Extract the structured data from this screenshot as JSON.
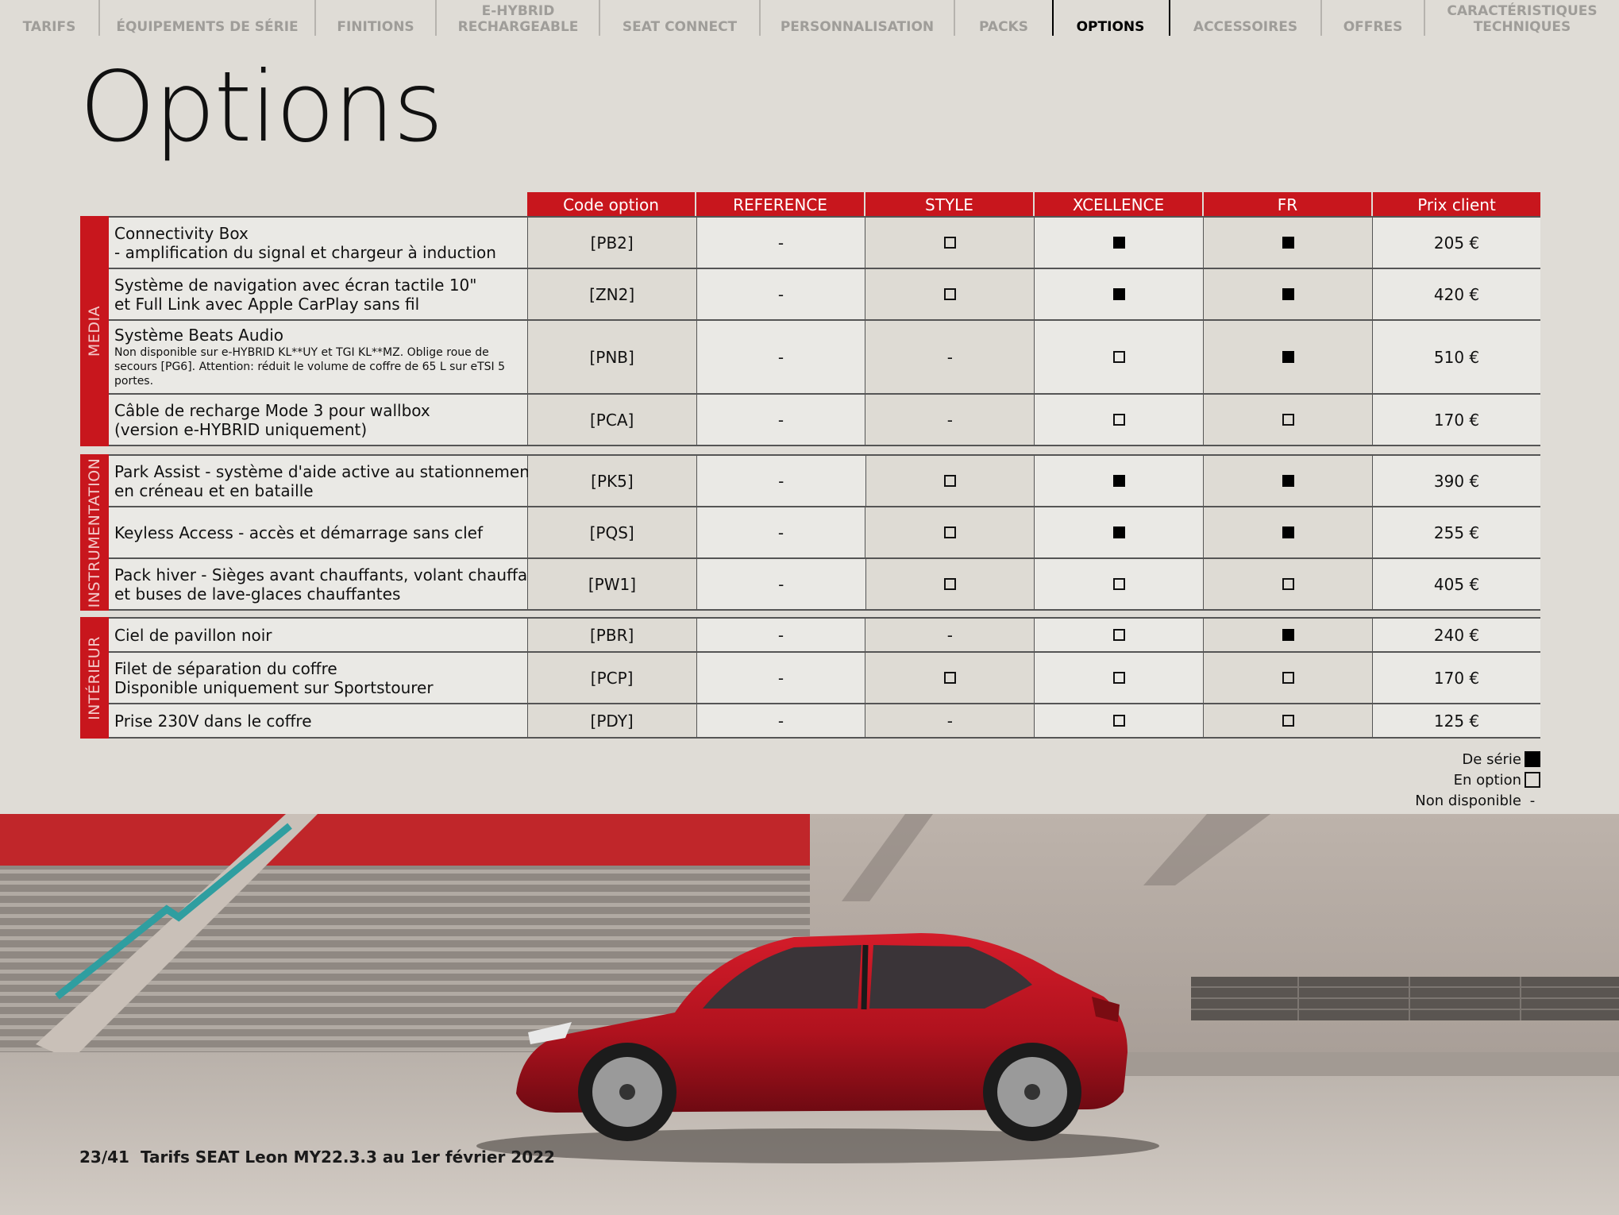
{
  "nav": {
    "items": [
      {
        "label": "TARIFS",
        "active": false
      },
      {
        "label": "ÉQUIPEMENTS DE SÉRIE",
        "active": false
      },
      {
        "label": "FINITIONS",
        "active": false
      },
      {
        "label": "e-HYBRID\nRECHARGEABLE",
        "active": false
      },
      {
        "label": "SEAT CONNECT",
        "active": false
      },
      {
        "label": "PERSONNALISATION",
        "active": false
      },
      {
        "label": "PACKS",
        "active": false
      },
      {
        "label": "OPTIONS",
        "active": true
      },
      {
        "label": "ACCESSOIRES",
        "active": false
      },
      {
        "label": "OFFRES",
        "active": false
      },
      {
        "label": "CARACTÉRISTIQUES\nTECHNIQUES",
        "active": false
      }
    ]
  },
  "title": "Options",
  "table": {
    "headers": [
      "Code option",
      "REFERENCE",
      "STYLE",
      "XCELLENCE",
      "FR",
      "Prix client"
    ],
    "groups": [
      {
        "label": "MEDIA",
        "rows": [
          {
            "desc": [
              "Connectivity Box",
              "- amplification du signal et chargeur à induction"
            ],
            "note": "",
            "code": "[PB2]",
            "ref": "-",
            "style": "option",
            "xcellence": "serie",
            "fr": "serie",
            "price": "205 €"
          },
          {
            "desc": [
              "Système de navigation avec écran tactile 10\"",
              "et Full Link avec Apple CarPlay sans fil"
            ],
            "note": "",
            "code": "[ZN2]",
            "ref": "-",
            "style": "option",
            "xcellence": "serie",
            "fr": "serie",
            "price": "420 €"
          },
          {
            "desc": [
              "Système Beats Audio"
            ],
            "note": "Non disponible sur e-HYBRID KL**UY et TGI KL**MZ. Oblige roue de secours [PG6]. Attention: réduit le volume de coffre de 65 L sur eTSI 5 portes.",
            "code": "[PNB]",
            "ref": "-",
            "style": "none",
            "xcellence": "option",
            "fr": "serie",
            "price": "510 €"
          },
          {
            "desc": [
              "Câble de recharge Mode 3 pour wallbox",
              "(version e-HYBRID uniquement)"
            ],
            "note": "",
            "code": "[PCA]",
            "ref": "-",
            "style": "none",
            "xcellence": "option",
            "fr": "option",
            "price": "170 €"
          }
        ]
      },
      {
        "label": "INSTRUMENTATION",
        "rows": [
          {
            "desc": [
              "Park Assist - système d'aide active au stationnement",
              "en créneau et en bataille"
            ],
            "note": "",
            "code": "[PK5]",
            "ref": "-",
            "style": "option",
            "xcellence": "serie",
            "fr": "serie",
            "price": "390 €"
          },
          {
            "desc": [
              "Keyless Access - accès et démarrage sans clef"
            ],
            "note": "",
            "code": "[PQS]",
            "ref": "-",
            "style": "option",
            "xcellence": "serie",
            "fr": "serie",
            "price": "255 €"
          },
          {
            "desc": [
              "Pack hiver - Sièges avant chauffants, volant chauffant",
              "et buses de lave-glaces chauffantes"
            ],
            "note": "",
            "code": "[PW1]",
            "ref": "-",
            "style": "option",
            "xcellence": "option",
            "fr": "option",
            "price": "405 €"
          }
        ]
      },
      {
        "label": "INTÉRIEUR",
        "rows": [
          {
            "desc": [
              "Ciel de pavillon noir"
            ],
            "note": "",
            "code": "[PBR]",
            "ref": "-",
            "style": "none",
            "xcellence": "option",
            "fr": "serie",
            "price": "240 €"
          },
          {
            "desc": [
              "Filet de séparation du coffre",
              "Disponible uniquement sur Sportstourer"
            ],
            "note": "",
            "code": "[PCP]",
            "ref": "-",
            "style": "option",
            "xcellence": "option",
            "fr": "option",
            "price": "170 €"
          },
          {
            "desc": [
              "Prise 230V dans le coffre"
            ],
            "note": "",
            "code": "[PDY]",
            "ref": "-",
            "style": "none",
            "xcellence": "option",
            "fr": "option",
            "price": "125 €"
          }
        ]
      }
    ]
  },
  "legend": {
    "serie": "De série",
    "option": "En option",
    "none": "Non disponible",
    "none_symbol": "-"
  },
  "footer": {
    "page": "23/41",
    "text": "Tarifs SEAT Leon MY22.3.3 au 1er février 2022"
  },
  "colors": {
    "accent": "#c8161d",
    "background": "#dfdcd6"
  }
}
